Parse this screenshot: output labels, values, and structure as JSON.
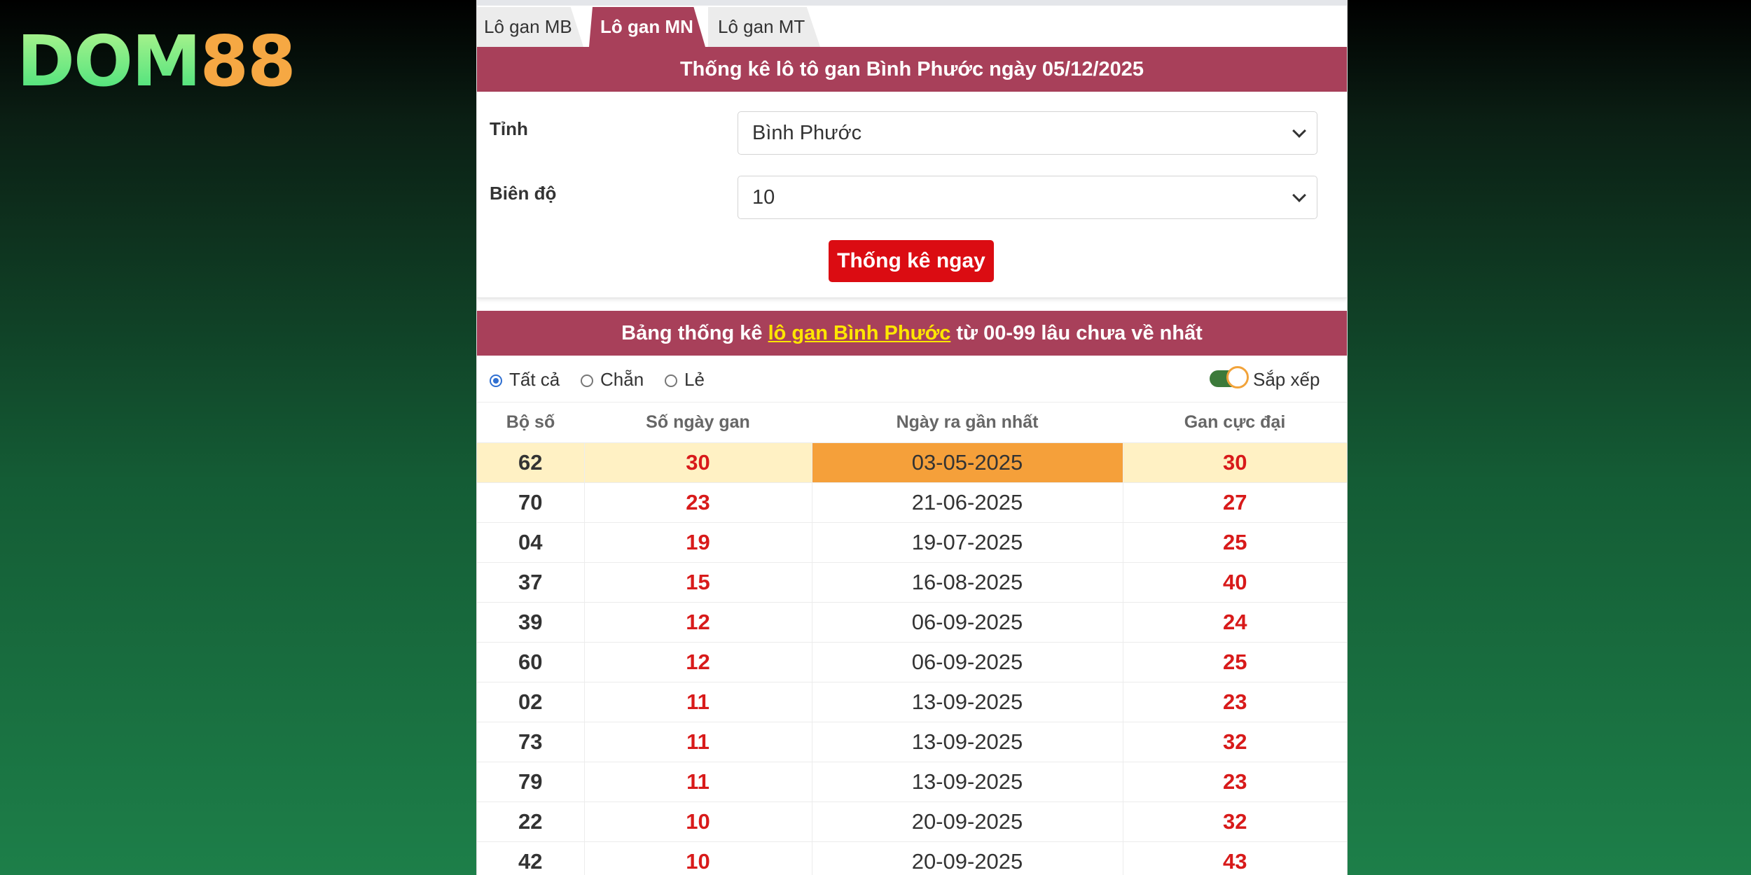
{
  "logo": {
    "part1": "DOM",
    "part2": "88",
    "colors": {
      "part1": "#4be37a",
      "part2": "#f6a843"
    }
  },
  "tabs": [
    {
      "label": "Lô gan MB",
      "active": false
    },
    {
      "label": "Lô gan MN",
      "active": true
    },
    {
      "label": "Lô gan MT",
      "active": false
    }
  ],
  "form": {
    "title": "Thống kê lô tô gan Bình Phước ngày 05/12/2025",
    "province_label": "Tỉnh",
    "province_value": "Bình Phước",
    "range_label": "Biên độ",
    "range_value": "10",
    "submit_label": "Thống kê ngay"
  },
  "results": {
    "title_before": "Bảng thống kê ",
    "title_link": "lô gan Bình Phước",
    "title_after": " từ 00-99 lâu chưa về nhất",
    "filters": [
      {
        "label": "Tất cả",
        "checked": true
      },
      {
        "label": "Chẵn",
        "checked": false
      },
      {
        "label": "Lẻ",
        "checked": false
      }
    ],
    "sort_label": "Sắp xếp",
    "sort_on": true,
    "columns": [
      "Bộ số",
      "Số ngày gan",
      "Ngày ra gần nhất",
      "Gan cực đại"
    ],
    "rows": [
      {
        "number": "62",
        "days": "30",
        "last_date": "03-05-2025",
        "max_gan": "30",
        "highlight": true
      },
      {
        "number": "70",
        "days": "23",
        "last_date": "21-06-2025",
        "max_gan": "27"
      },
      {
        "number": "04",
        "days": "19",
        "last_date": "19-07-2025",
        "max_gan": "25"
      },
      {
        "number": "37",
        "days": "15",
        "last_date": "16-08-2025",
        "max_gan": "40"
      },
      {
        "number": "39",
        "days": "12",
        "last_date": "06-09-2025",
        "max_gan": "24"
      },
      {
        "number": "60",
        "days": "12",
        "last_date": "06-09-2025",
        "max_gan": "25"
      },
      {
        "number": "02",
        "days": "11",
        "last_date": "13-09-2025",
        "max_gan": "23"
      },
      {
        "number": "73",
        "days": "11",
        "last_date": "13-09-2025",
        "max_gan": "32"
      },
      {
        "number": "79",
        "days": "11",
        "last_date": "13-09-2025",
        "max_gan": "23"
      },
      {
        "number": "22",
        "days": "10",
        "last_date": "20-09-2025",
        "max_gan": "32"
      },
      {
        "number": "42",
        "days": "10",
        "last_date": "20-09-2025",
        "max_gan": "43"
      }
    ]
  },
  "colors": {
    "header_bg": "#a8405a",
    "button_bg": "#db0c12",
    "link_color": "#ffe600",
    "value_red": "#d81a1a",
    "highlight_row": "#fff1c4",
    "highlight_cell": "#f5a03a"
  }
}
